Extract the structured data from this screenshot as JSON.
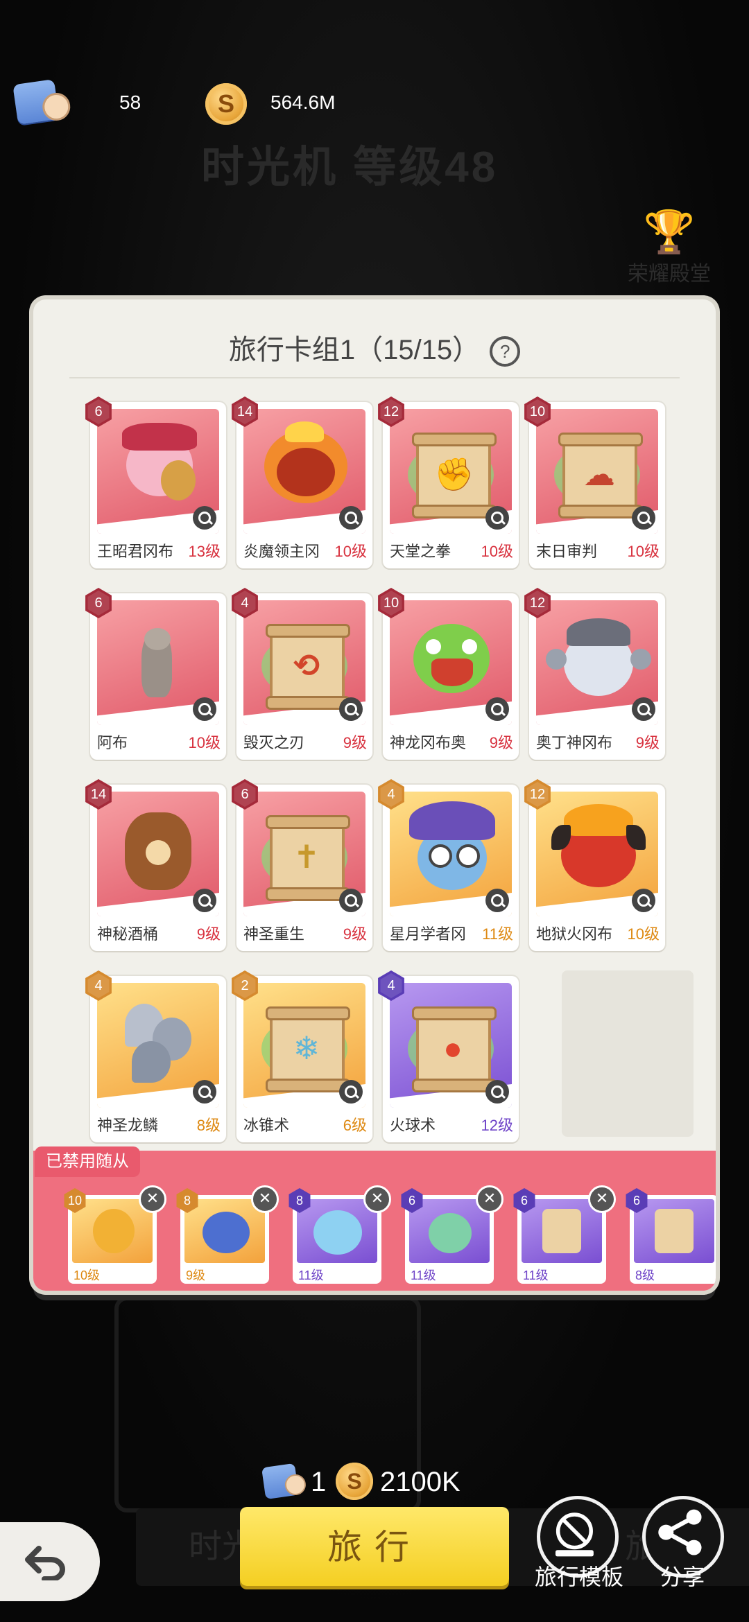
{
  "header": {
    "tickets": "58",
    "coins": "564.6M",
    "coin_symbol": "S"
  },
  "background": {
    "title": "时光机 等级48",
    "side_label": "荣耀殿堂",
    "footer_left": "时光",
    "footer_right": "旅"
  },
  "deck": {
    "title": "旅行卡组1（15/15）",
    "help": "?",
    "cards": [
      {
        "count": "6",
        "name": "王昭君冈布",
        "level": "13级",
        "rarity": "red",
        "art": "char-pink"
      },
      {
        "count": "14",
        "name": "炎魔领主冈",
        "level": "10级",
        "rarity": "red",
        "art": "char-fire"
      },
      {
        "count": "12",
        "name": "天堂之拳",
        "level": "10级",
        "rarity": "red",
        "art": "scroll-fist"
      },
      {
        "count": "10",
        "name": "末日审判",
        "level": "10级",
        "rarity": "red",
        "art": "scroll-doom"
      },
      {
        "count": "6",
        "name": "阿布",
        "level": "10级",
        "rarity": "red",
        "art": "cat"
      },
      {
        "count": "4",
        "name": "毁灭之刃",
        "level": "9级",
        "rarity": "red",
        "art": "scroll-blade"
      },
      {
        "count": "10",
        "name": "神龙冈布奥",
        "level": "9级",
        "rarity": "red",
        "art": "char-dragon"
      },
      {
        "count": "12",
        "name": "奥丁神冈布",
        "level": "9级",
        "rarity": "red",
        "art": "char-odin"
      },
      {
        "count": "14",
        "name": "神秘酒桶",
        "level": "9级",
        "rarity": "red",
        "art": "barrel"
      },
      {
        "count": "6",
        "name": "神圣重生",
        "level": "9级",
        "rarity": "red",
        "art": "scroll-cross"
      },
      {
        "count": "4",
        "name": "星月学者冈",
        "level": "11级",
        "rarity": "gold",
        "art": "char-wizard"
      },
      {
        "count": "12",
        "name": "地狱火冈布",
        "level": "10级",
        "rarity": "gold",
        "art": "char-hellfire"
      },
      {
        "count": "4",
        "name": "神圣龙鳞",
        "level": "8级",
        "rarity": "gold",
        "art": "scales"
      },
      {
        "count": "2",
        "name": "冰锥术",
        "level": "6级",
        "rarity": "gold",
        "art": "scroll-ice"
      },
      {
        "count": "4",
        "name": "火球术",
        "level": "12级",
        "rarity": "purple",
        "art": "scroll-fire"
      }
    ]
  },
  "banned": {
    "label": "已禁用随从",
    "items": [
      {
        "count": "10",
        "level": "10级",
        "rarity": "gold"
      },
      {
        "count": "8",
        "level": "9级",
        "rarity": "gold"
      },
      {
        "count": "8",
        "level": "11级",
        "rarity": "purple"
      },
      {
        "count": "6",
        "level": "11级",
        "rarity": "purple"
      },
      {
        "count": "6",
        "level": "11级",
        "rarity": "purple"
      },
      {
        "count": "6",
        "level": "8级",
        "rarity": "purple"
      }
    ],
    "remove_symbol": "✕"
  },
  "bottom": {
    "cost_tickets": "1",
    "cost_coins": "2100K",
    "travel_label": "旅行",
    "template_label": "旅行模板",
    "share_label": "分享"
  }
}
